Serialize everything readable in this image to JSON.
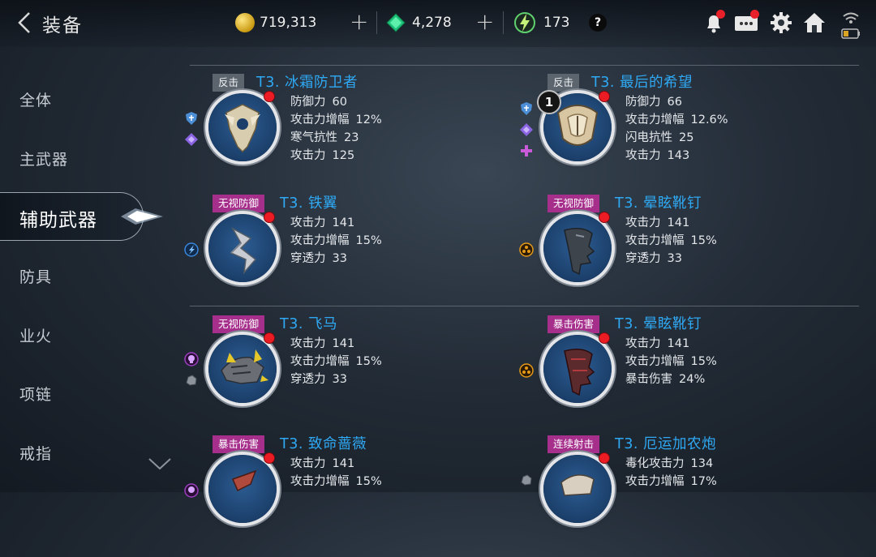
{
  "header": {
    "title": "装备",
    "gold": "719,313",
    "gems": "4,278",
    "stamina": "173",
    "help_label": "?",
    "plus": "+"
  },
  "nav": {
    "items": [
      {
        "label": "全体"
      },
      {
        "label": "主武器"
      },
      {
        "label": "辅助武器",
        "active": true
      },
      {
        "label": "防具"
      },
      {
        "label": "业火"
      },
      {
        "label": "项链"
      },
      {
        "label": "戒指"
      }
    ]
  },
  "items": [
    {
      "tag": "反击",
      "tag_color": "gray",
      "name": "T3. 冰霜防卫者",
      "badge": "",
      "stats": [
        {
          "k": "防御力",
          "v": "60"
        },
        {
          "k": "攻击力增幅",
          "v": "12%"
        },
        {
          "k": "寒气抗性",
          "v": "23"
        },
        {
          "k": "攻击力",
          "v": "125"
        }
      ],
      "side_icons": [
        "shield-icon",
        "gem-icon"
      ]
    },
    {
      "tag": "反击",
      "tag_color": "gray",
      "name": "T3. 最后的希望",
      "badge": "1",
      "stats": [
        {
          "k": "防御力",
          "v": "66"
        },
        {
          "k": "攻击力增幅",
          "v": "12.6%"
        },
        {
          "k": "闪电抗性",
          "v": "25"
        },
        {
          "k": "攻击力",
          "v": "143"
        }
      ],
      "side_icons": [
        "shield-icon",
        "gem-icon",
        "cross-icon"
      ]
    },
    {
      "tag": "无视防御",
      "tag_color": "pink",
      "name": "T3. 铁翼",
      "badge": "",
      "stats": [
        {
          "k": "攻击力",
          "v": "141"
        },
        {
          "k": "攻击力增幅",
          "v": "15%"
        },
        {
          "k": "穿透力",
          "v": "33"
        }
      ],
      "side_icons": [
        "bolt-icon"
      ]
    },
    {
      "tag": "无视防御",
      "tag_color": "pink",
      "name": "T3. 晕眩靴钉",
      "badge": "",
      "stats": [
        {
          "k": "攻击力",
          "v": "141"
        },
        {
          "k": "攻击力增幅",
          "v": "15%"
        },
        {
          "k": "穿透力",
          "v": "33"
        }
      ],
      "side_icons": [
        "hazard-icon"
      ]
    },
    {
      "tag": "无视防御",
      "tag_color": "pink",
      "name": "T3. 飞马",
      "badge": "",
      "stats": [
        {
          "k": "攻击力",
          "v": "141"
        },
        {
          "k": "攻击力增幅",
          "v": "15%"
        },
        {
          "k": "穿透力",
          "v": "33"
        }
      ],
      "side_icons": [
        "skull-icon",
        "rock-icon"
      ]
    },
    {
      "tag": "暴击伤害",
      "tag_color": "pink",
      "name": "T3. 晕眩靴钉",
      "badge": "",
      "stats": [
        {
          "k": "攻击力",
          "v": "141"
        },
        {
          "k": "攻击力增幅",
          "v": "15%"
        },
        {
          "k": "暴击伤害",
          "v": "24%"
        }
      ],
      "side_icons": [
        "hazard-icon"
      ]
    },
    {
      "tag": "暴击伤害",
      "tag_color": "pink",
      "name": "T3. 致命蔷薇",
      "badge": "",
      "stats": [
        {
          "k": "攻击力",
          "v": "141"
        },
        {
          "k": "攻击力增幅",
          "v": "15%"
        }
      ],
      "side_icons": [
        "skull-icon"
      ]
    },
    {
      "tag": "连续射击",
      "tag_color": "pink",
      "name": "T3. 厄运加农炮",
      "badge": "",
      "stats": [
        {
          "k": "毒化攻击力",
          "v": "134"
        },
        {
          "k": "攻击力增幅",
          "v": "17%"
        }
      ],
      "side_icons": [
        "rock-icon"
      ]
    }
  ],
  "colors": {
    "accent_blue": "#2fa9f4",
    "tag_pink": "#a62f8c",
    "tag_gray": "#5c646e",
    "notify_red": "#e8202a"
  }
}
